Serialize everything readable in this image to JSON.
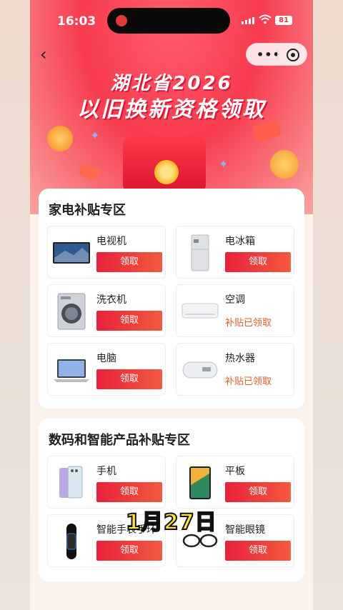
{
  "status": {
    "time": "16:03",
    "battery": "81"
  },
  "banner": {
    "line1": "湖北省2026",
    "line2": "以旧换新资格领取"
  },
  "sections": [
    {
      "title": "家电补贴专区",
      "items": [
        {
          "name": "电视机",
          "action": "领取",
          "state": "button"
        },
        {
          "name": "电冰箱",
          "action": "领取",
          "state": "button"
        },
        {
          "name": "洗衣机",
          "action": "领取",
          "state": "button"
        },
        {
          "name": "空调",
          "action": "补贴已领取",
          "state": "claimed"
        },
        {
          "name": "电脑",
          "action": "领取",
          "state": "button"
        },
        {
          "name": "热水器",
          "action": "补贴已领取",
          "state": "claimed"
        }
      ]
    },
    {
      "title": "数码和智能产品补贴专区",
      "items": [
        {
          "name": "手机",
          "action": "领取",
          "state": "button"
        },
        {
          "name": "平板",
          "action": "领取",
          "state": "button"
        },
        {
          "name": "智能手表手环",
          "action": "领取",
          "state": "button"
        },
        {
          "name": "智能眼镜",
          "action": "领取",
          "state": "button"
        }
      ]
    }
  ],
  "overlay": {
    "date_caption": "1月27日"
  },
  "colors": {
    "brand_red": "#e8213c",
    "claimed_orange": "#d9622b",
    "caption_yellow": "#ffe640"
  }
}
